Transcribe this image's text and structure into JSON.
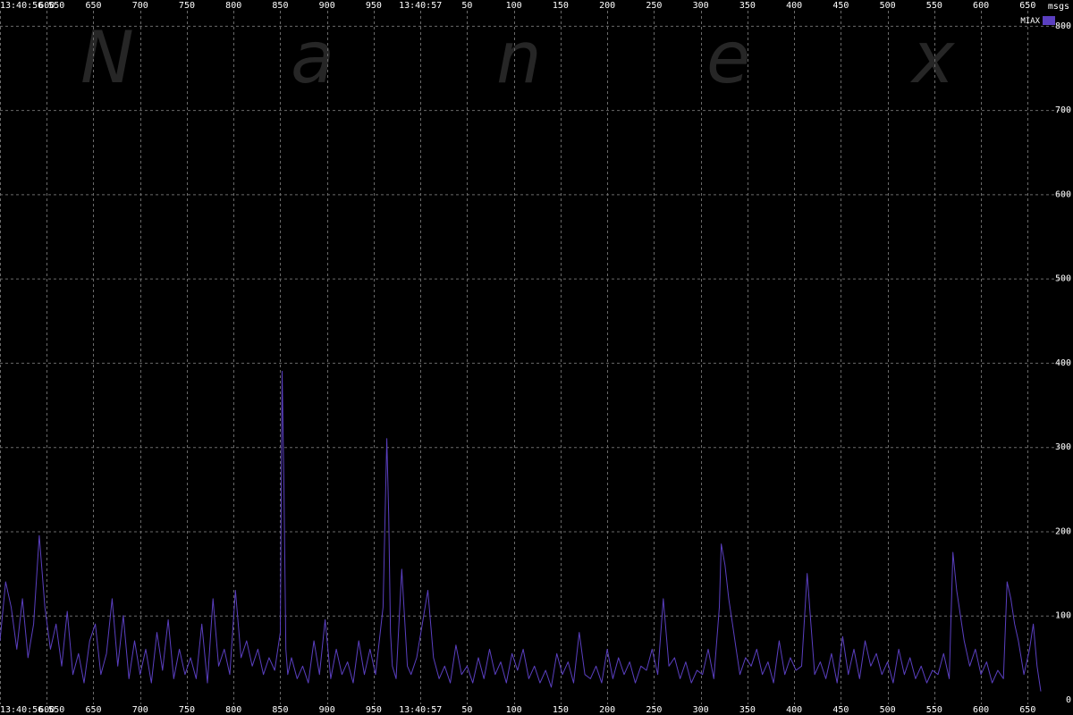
{
  "chart_data": {
    "type": "line",
    "title": "",
    "xlabel": "",
    "ylabel": "msgs",
    "unit_label": "msgs",
    "watermark": [
      "N",
      "a",
      "n",
      "e",
      "x"
    ],
    "x_tick_labels": [
      "13:40:56.550",
      "600",
      "650",
      "700",
      "750",
      "800",
      "850",
      "900",
      "950",
      "13:40:57",
      "50",
      "100",
      "150",
      "200",
      "250",
      "300",
      "350",
      "400",
      "450",
      "500",
      "550",
      "600",
      "650"
    ],
    "x_tick_ms": [
      550,
      600,
      650,
      700,
      750,
      800,
      850,
      900,
      950,
      1000,
      1050,
      1100,
      1150,
      1200,
      1250,
      1300,
      1350,
      1400,
      1450,
      1500,
      1550,
      1600,
      1650
    ],
    "xlim_ms": [
      550,
      1665
    ],
    "major_tick": "13:40:57",
    "y_ticks": [
      0,
      100,
      200,
      300,
      400,
      500,
      600,
      700,
      800
    ],
    "ylim": [
      0,
      820
    ],
    "grid": true,
    "legend_position": "top-right",
    "series": [
      {
        "name": "MIAX",
        "color": "#5a3fc0",
        "x_ms": [
          550,
          556,
          562,
          568,
          574,
          580,
          586,
          592,
          598,
          604,
          610,
          616,
          622,
          628,
          634,
          640,
          646,
          652,
          658,
          664,
          670,
          676,
          682,
          688,
          694,
          700,
          706,
          712,
          718,
          724,
          730,
          736,
          742,
          748,
          754,
          760,
          766,
          772,
          778,
          784,
          790,
          796,
          802,
          808,
          814,
          820,
          826,
          832,
          838,
          844,
          850,
          852,
          854,
          856,
          858,
          862,
          868,
          874,
          880,
          886,
          892,
          898,
          904,
          910,
          916,
          922,
          928,
          934,
          940,
          946,
          952,
          960,
          964,
          966,
          968,
          970,
          974,
          980,
          986,
          990,
          996,
          1002,
          1008,
          1014,
          1020,
          1026,
          1032,
          1038,
          1044,
          1050,
          1056,
          1062,
          1068,
          1074,
          1080,
          1086,
          1092,
          1098,
          1104,
          1110,
          1116,
          1122,
          1128,
          1134,
          1140,
          1146,
          1152,
          1158,
          1164,
          1170,
          1176,
          1182,
          1188,
          1194,
          1200,
          1206,
          1212,
          1218,
          1224,
          1230,
          1236,
          1242,
          1248,
          1254,
          1260,
          1266,
          1272,
          1278,
          1284,
          1290,
          1296,
          1302,
          1308,
          1314,
          1320,
          1322,
          1326,
          1330,
          1334,
          1338,
          1342,
          1348,
          1354,
          1360,
          1366,
          1372,
          1378,
          1384,
          1390,
          1396,
          1402,
          1408,
          1414,
          1418,
          1422,
          1428,
          1434,
          1440,
          1446,
          1452,
          1458,
          1464,
          1470,
          1476,
          1482,
          1488,
          1494,
          1500,
          1506,
          1512,
          1518,
          1524,
          1530,
          1536,
          1542,
          1548,
          1554,
          1560,
          1566,
          1570,
          1574,
          1578,
          1582,
          1588,
          1594,
          1600,
          1606,
          1612,
          1618,
          1624,
          1628,
          1632,
          1636,
          1640,
          1646,
          1652,
          1656,
          1660,
          1664
        ],
        "values": [
          70,
          140,
          110,
          60,
          120,
          50,
          90,
          195,
          110,
          60,
          90,
          40,
          105,
          30,
          55,
          20,
          70,
          90,
          30,
          55,
          120,
          40,
          100,
          25,
          70,
          30,
          60,
          20,
          80,
          35,
          95,
          25,
          60,
          30,
          50,
          25,
          90,
          20,
          120,
          40,
          60,
          30,
          130,
          50,
          70,
          40,
          60,
          30,
          50,
          35,
          80,
          390,
          250,
          60,
          30,
          50,
          25,
          40,
          20,
          70,
          30,
          95,
          25,
          60,
          30,
          45,
          20,
          70,
          30,
          60,
          30,
          110,
          310,
          220,
          80,
          40,
          25,
          155,
          40,
          30,
          50,
          90,
          130,
          50,
          25,
          40,
          20,
          65,
          30,
          40,
          20,
          50,
          25,
          60,
          30,
          45,
          20,
          55,
          35,
          60,
          25,
          40,
          20,
          35,
          15,
          55,
          30,
          45,
          20,
          80,
          30,
          25,
          40,
          20,
          60,
          25,
          50,
          30,
          45,
          20,
          40,
          35,
          60,
          30,
          120,
          40,
          50,
          25,
          45,
          20,
          35,
          30,
          60,
          25,
          110,
          185,
          160,
          120,
          90,
          60,
          30,
          50,
          40,
          60,
          30,
          45,
          20,
          70,
          30,
          50,
          35,
          40,
          150,
          90,
          30,
          45,
          25,
          55,
          20,
          75,
          30,
          60,
          25,
          70,
          40,
          55,
          30,
          45,
          20,
          60,
          30,
          50,
          25,
          40,
          20,
          35,
          30,
          55,
          25,
          175,
          130,
          100,
          70,
          40,
          60,
          30,
          45,
          20,
          35,
          25,
          140,
          120,
          90,
          70,
          30,
          60,
          90,
          40,
          10,
          15,
          10
        ]
      }
    ]
  }
}
